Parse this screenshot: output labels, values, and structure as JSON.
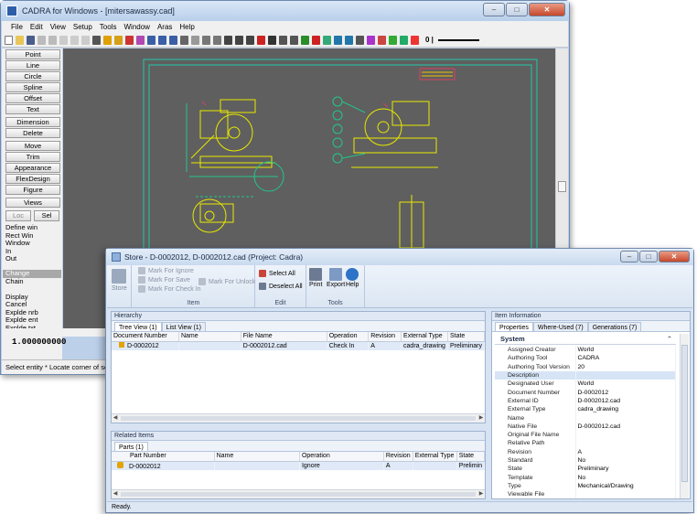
{
  "cadra": {
    "title": "CADRA for Windows - [mitersawassy.cad]",
    "window_buttons": [
      "–",
      "□",
      "✕"
    ],
    "menu": [
      "File",
      "Edit",
      "View",
      "Setup",
      "Tools",
      "Window",
      "Aras",
      "Help"
    ],
    "line_value": "0 |",
    "commands": [
      "Point",
      "Line",
      "Circle",
      "Spline",
      "Offset",
      "Text",
      "Dimension",
      "Delete",
      "Move",
      "Trim",
      "Appearance",
      "FlexDesign",
      "Figure",
      "Views"
    ],
    "loc_label": "Loc",
    "sel_label": "Sel",
    "text_cmds": [
      "Define win",
      "Rect  Win",
      "Window",
      "In",
      "Out"
    ],
    "text_cmds2": [
      "Change",
      "Chain",
      "",
      "Display",
      "Cancel",
      "Explde nrb",
      "Explde ent",
      "Explde txt"
    ],
    "command_value": "1.000000000",
    "status": "Select entity * Locate corner of selection rectangle"
  },
  "store": {
    "title": "Store  - D-0002012, D-0002012.cad (Project: Cadra)",
    "ribbon": {
      "store_label": "Store",
      "mark_ignore": "Mark For Ignore",
      "mark_save": "Mark For Save",
      "mark_checkin": "Mark For Check In",
      "mark_unlock": "Mark For Unlock",
      "item_group": "Item",
      "select_all": "Select All",
      "deselect_all": "Deselect All",
      "edit_group": "Edit",
      "print": "Print",
      "export": "Export",
      "help": "Help",
      "tools_group": "Tools"
    },
    "hierarchy": {
      "title": "Hierarchy",
      "tabs": [
        "Tree View (1)",
        "List View (1)"
      ],
      "columns": [
        "Document Number",
        "Name",
        "File Name",
        "Operation",
        "Revision",
        "External Type",
        "State"
      ],
      "rows": [
        [
          "D-0002012",
          "",
          "D-0002012.cad",
          "Check In",
          "A",
          "cadra_drawing",
          "Preliminary"
        ]
      ]
    },
    "related": {
      "title": "Related Items",
      "tabs": [
        "Parts (1)"
      ],
      "columns": [
        "Part Number",
        "Name",
        "Operation",
        "Revision",
        "External Type",
        "State"
      ],
      "rows": [
        [
          "D-0002012",
          "",
          "Ignore",
          "A",
          "",
          "Prelimin"
        ]
      ]
    },
    "info": {
      "title": "Item Information",
      "tabs": [
        "Properties",
        "Where-Used (7)",
        "Generations (7)"
      ],
      "section": "System",
      "props": [
        [
          "Assigned Creator",
          "World"
        ],
        [
          "Authoring Tool",
          "CADRA"
        ],
        [
          "Authoring Tool Version",
          "20"
        ],
        [
          "Description",
          ""
        ],
        [
          "Designated User",
          "World"
        ],
        [
          "Document Number",
          "D-0002012"
        ],
        [
          "External ID",
          "D-0002012.cad"
        ],
        [
          "External Type",
          "cadra_drawing"
        ],
        [
          "Name",
          ""
        ],
        [
          "Native File",
          "D-0002012.cad"
        ],
        [
          "Original File Name",
          ""
        ],
        [
          "Relative Path",
          ""
        ],
        [
          "Revision",
          "A"
        ],
        [
          "Standard",
          "No"
        ],
        [
          "State",
          "Preliminary"
        ],
        [
          "Template",
          "No"
        ],
        [
          "Type",
          "Mechanical/Drawing"
        ],
        [
          "Viewable File",
          ""
        ]
      ]
    },
    "status": "Ready."
  }
}
